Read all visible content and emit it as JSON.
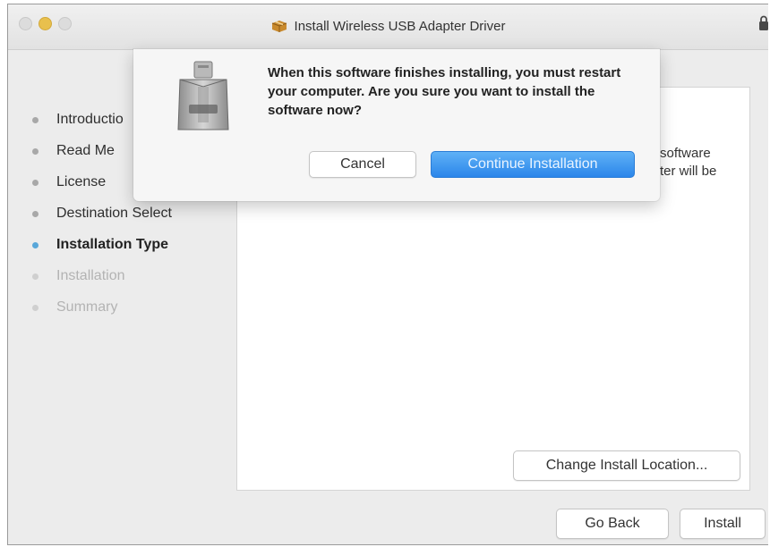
{
  "window": {
    "title": "Install Wireless USB Adapter Driver",
    "accent_color": "#2b86ea",
    "app_icon": "package-installer-icon",
    "lock_icon": "lock-icon"
  },
  "sidebar": {
    "items": [
      {
        "label": "Introductio",
        "state": "done"
      },
      {
        "label": "Read Me",
        "state": "done"
      },
      {
        "label": "License",
        "state": "done"
      },
      {
        "label": "Destination Select",
        "state": "done"
      },
      {
        "label": "Installation Type",
        "state": "active"
      },
      {
        "label": "Installation",
        "state": "pending"
      },
      {
        "label": "Summary",
        "state": "pending"
      }
    ]
  },
  "content": {
    "text_line1": "software",
    "text_line2": "ter will be",
    "change_location_label": "Change Install Location..."
  },
  "footer": {
    "go_back_label": "Go Back",
    "install_label": "Install"
  },
  "dialog": {
    "message": "When this software finishes installing, you must restart your computer. Are you sure you want to install the software now?",
    "cancel_label": "Cancel",
    "continue_label": "Continue Installation",
    "icon": "installer-box-icon"
  }
}
